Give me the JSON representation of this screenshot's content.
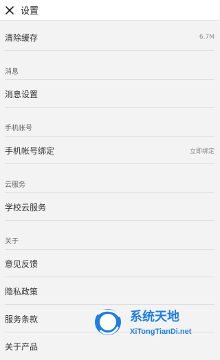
{
  "header": {
    "title": "设置"
  },
  "rows": [
    {
      "label": "清除缓存",
      "value": "6.7M"
    },
    {
      "section": "消息"
    },
    {
      "label": "消息设置"
    },
    {
      "section": "手机帐号"
    },
    {
      "label": "手机帐号绑定",
      "value": "立即绑定"
    },
    {
      "section": "云服务"
    },
    {
      "label": "学校云服务"
    },
    {
      "section": "关于"
    },
    {
      "label": "意见反馈"
    },
    {
      "label": "隐私政策"
    },
    {
      "label": "服务条款"
    },
    {
      "label": "关于产品"
    }
  ],
  "watermark": {
    "main": "系统天地",
    "sub": "XiTongTianDi.net"
  },
  "colors": {
    "background": "#f3f3f3",
    "header": "#ffffff",
    "divider": "#dedede",
    "text": "#2f2f2f",
    "secondary": "#8a8a8a",
    "watermark_blue": "#1f7de3"
  },
  "icons": {
    "close": "close-icon",
    "watermark_logo": "logo-icon"
  }
}
